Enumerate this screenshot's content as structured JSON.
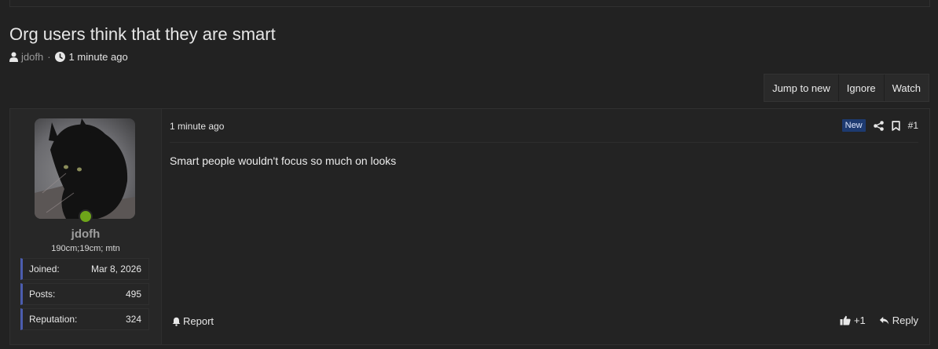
{
  "thread": {
    "title": "Org users think that they are smart",
    "author": "jdofh",
    "separator": "·",
    "time": "1 minute ago"
  },
  "actions": {
    "jump_to_new": "Jump to new",
    "ignore": "Ignore",
    "watch": "Watch"
  },
  "post": {
    "time": "1 minute ago",
    "badge": "New",
    "number": "#1",
    "body": "Smart people wouldn't focus so much on looks",
    "report_label": "Report",
    "reaction_count": "+1",
    "reply_label": "Reply",
    "user": {
      "name": "jdofh",
      "title": "190cm;19cm; mtn",
      "online": true,
      "stats": [
        {
          "label": "Joined:",
          "value": "Mar 8, 2026"
        },
        {
          "label": "Posts:",
          "value": "495"
        },
        {
          "label": "Reputation:",
          "value": "324"
        }
      ]
    }
  },
  "icons": {
    "author": "user-icon",
    "time": "clock-icon",
    "share": "share-icon",
    "bookmark": "bookmark-icon",
    "report": "bell-icon",
    "like": "thumbs-up-icon",
    "reply": "reply-icon"
  },
  "colors": {
    "background": "#222222",
    "accent_border": "#4b5dae",
    "badge": "#1d3a70",
    "online": "#6ea51a"
  }
}
